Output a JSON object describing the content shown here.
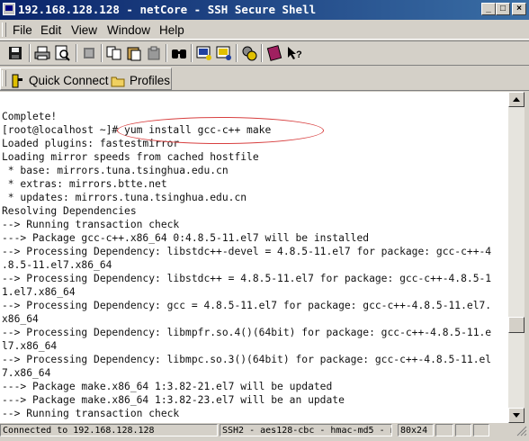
{
  "window": {
    "title": "192.168.128.128 - netCore - SSH Secure Shell",
    "minimize_icon": "minimize-icon",
    "maximize_icon": "maximize-icon",
    "close_icon": "close-icon"
  },
  "menu": {
    "items": [
      {
        "label": "File"
      },
      {
        "label": "Edit"
      },
      {
        "label": "View"
      },
      {
        "label": "Window"
      },
      {
        "label": "Help"
      }
    ]
  },
  "toolbar": {
    "icons": [
      "save-icon",
      "print-icon",
      "print-preview-icon",
      "connect-icon",
      "copy-icon",
      "paste-icon",
      "paste-selection-icon",
      "find-icon",
      "new-terminal-icon",
      "file-transfer-icon",
      "settings-icon",
      "help-book-icon",
      "context-help-icon"
    ]
  },
  "quickbar": {
    "quick_connect": "Quick Connect",
    "profiles": "Profiles"
  },
  "terminal": {
    "lines": [
      "Complete!",
      "[root@localhost ~]# yum install gcc-c++ make",
      "Loaded plugins: fastestmirror",
      "Loading mirror speeds from cached hostfile",
      " * base: mirrors.tuna.tsinghua.edu.cn",
      " * extras: mirrors.btte.net",
      " * updates: mirrors.tuna.tsinghua.edu.cn",
      "Resolving Dependencies",
      "--> Running transaction check",
      "---> Package gcc-c++.x86_64 0:4.8.5-11.el7 will be installed",
      "--> Processing Dependency: libstdc++-devel = 4.8.5-11.el7 for package: gcc-c++-4",
      ".8.5-11.el7.x86_64",
      "--> Processing Dependency: libstdc++ = 4.8.5-11.el7 for package: gcc-c++-4.8.5-1",
      "1.el7.x86_64",
      "--> Processing Dependency: gcc = 4.8.5-11.el7 for package: gcc-c++-4.8.5-11.el7.",
      "x86_64",
      "--> Processing Dependency: libmpfr.so.4()(64bit) for package: gcc-c++-4.8.5-11.e",
      "l7.x86_64",
      "--> Processing Dependency: libmpc.so.3()(64bit) for package: gcc-c++-4.8.5-11.el",
      "7.x86_64",
      "---> Package make.x86_64 1:3.82-21.el7 will be updated",
      "---> Package make.x86_64 1:3.82-23.el7 will be an update",
      "--> Running transaction check"
    ]
  },
  "status": {
    "connection": "Connected to 192.168.128.128",
    "cipher": "SSH2 - aes128-cbc - hmac-md5 - n",
    "size": "80x24"
  }
}
